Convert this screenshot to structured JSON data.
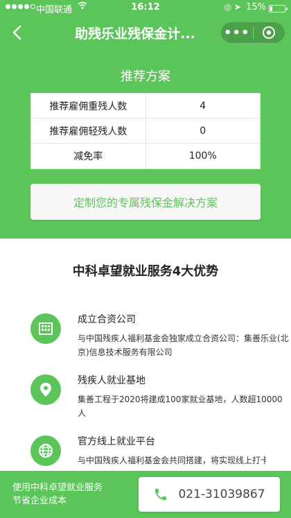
{
  "status_bar": {
    "carrier": "中国联通",
    "time": "16:12",
    "battery": "15%",
    "battery_level": 0.15
  },
  "nav": {
    "title": "助残乐业残保金计...",
    "more_label": "•••"
  },
  "plan": {
    "title": "推荐方案",
    "rows": [
      {
        "label": "推荐雇佣重残人数",
        "value": "4"
      },
      {
        "label": "推荐雇佣轻残人数",
        "value": "0"
      },
      {
        "label": "减免率",
        "value": "100%"
      }
    ],
    "custom_button_label": "定制您的专属残保金解决方案"
  },
  "advantages": {
    "heading": "中科卓望就业服务4大优势",
    "items": [
      {
        "icon": "building-icon",
        "title": "成立合资公司",
        "desc": "与中国残疾人福利基金会独家成立合资公司：集善乐业(北京)信息技术服务有限公司"
      },
      {
        "icon": "location-pin-icon",
        "title": "残疾人就业基地",
        "desc": "集善工程于2020将建成100家就业基地，人数超10000人"
      },
      {
        "icon": "globe-icon",
        "title": "官方线上就业平台",
        "desc": "与中国残疾人福利基金会共同搭建，将实现线上打卡、培训、众包等业务"
      }
    ]
  },
  "footer": {
    "line1": "使用中科卓望就业服务",
    "line2": "节省企业成本",
    "phone": "021-31039867"
  }
}
